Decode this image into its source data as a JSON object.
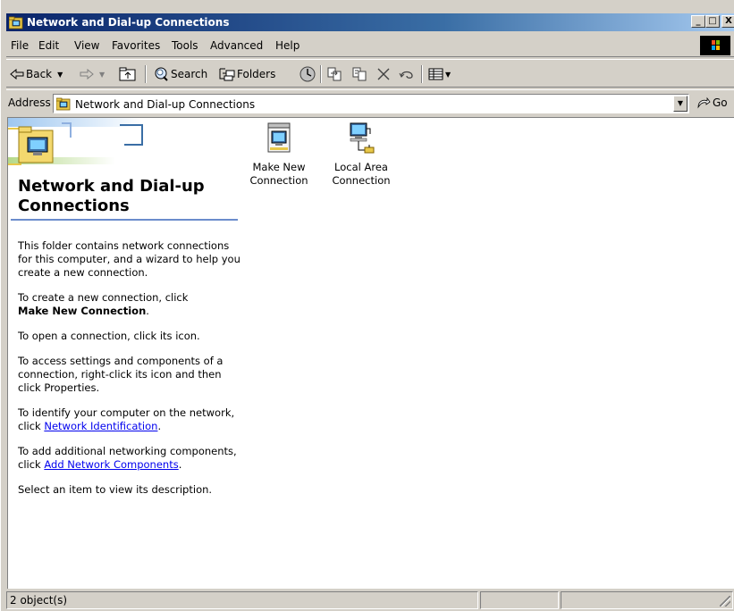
{
  "window": {
    "title": "Network and Dial-up Connections",
    "minimize_label": "_",
    "maximize_label": "□",
    "close_label": "X"
  },
  "menu": [
    "File",
    "Edit",
    "View",
    "Favorites",
    "Tools",
    "Advanced",
    "Help"
  ],
  "toolbar": {
    "back_label": "Back",
    "search_label": "Search",
    "folders_label": "Folders"
  },
  "address": {
    "label": "Address",
    "value": "Network and Dial-up Connections",
    "go_label": "Go"
  },
  "sidebar": {
    "title": "Network and Dial-up Connections",
    "intro": "This folder contains network connections for this computer, and a wizard to help you create a new connection.",
    "create_prefix": "To create a new connection, click",
    "create_bold": "Make New Connection",
    "create_suffix": ".",
    "open_text": "To open a connection, click its icon.",
    "settings_text": "To access settings and components of a connection, right-click its icon and then click Properties.",
    "identify_prefix": "To identify your computer on the network, click",
    "identify_link": "Network Identification",
    "identify_suffix": ".",
    "add_prefix": "To add additional networking components, click",
    "add_link": "Add Network Components",
    "add_suffix": ".",
    "select_text": "Select an item to view its description."
  },
  "items": [
    {
      "label_line1": "Make New",
      "label_line2": "Connection"
    },
    {
      "label_line1": "Local Area",
      "label_line2": "Connection"
    }
  ],
  "status": {
    "count": "2 object(s)"
  },
  "colors": {
    "title_active": "#0a246a",
    "face": "#d4d0c8",
    "link": "#0000ee"
  }
}
